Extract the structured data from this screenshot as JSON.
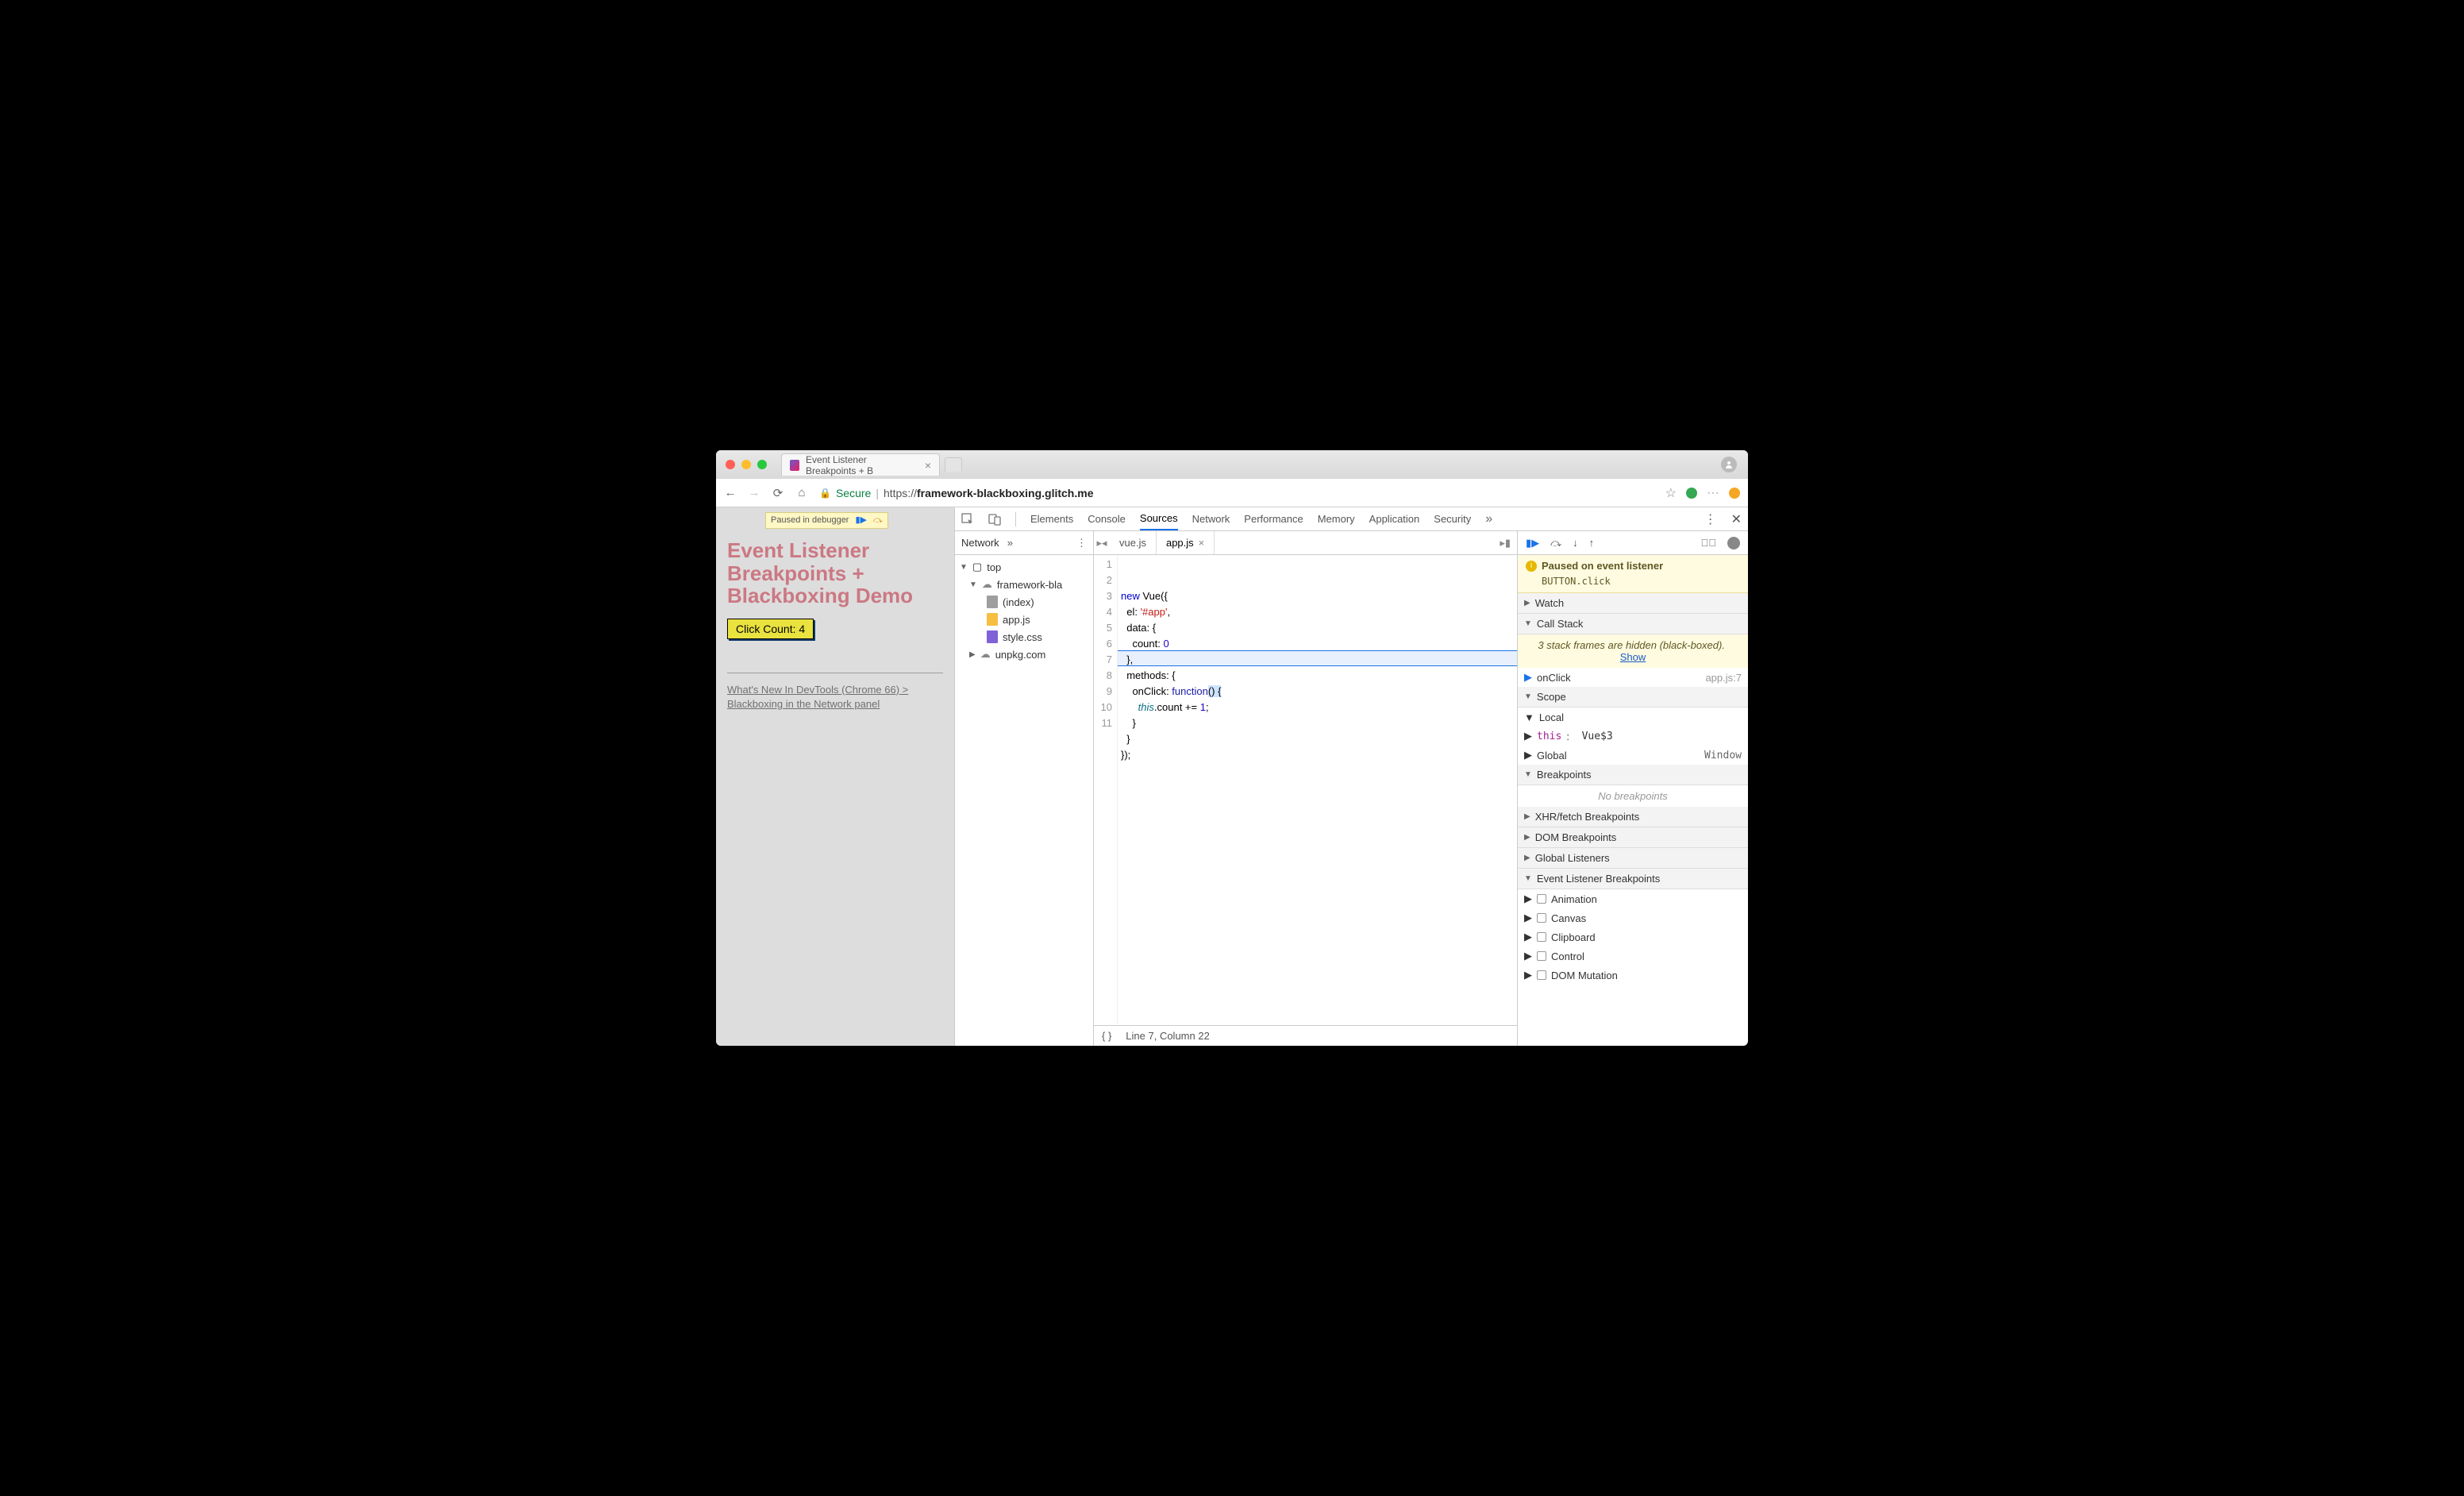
{
  "browser": {
    "tab_title": "Event Listener Breakpoints + B",
    "url_secure_label": "Secure",
    "url_display_host": "framework-blackboxing.glitch.me",
    "url_display_prefix": "https://"
  },
  "page": {
    "paused_pill": "Paused in debugger",
    "heading": "Event Listener Breakpoints + Blackboxing Demo",
    "button_label": "Click Count: 4",
    "link_text": "What's New In DevTools (Chrome 66) > Blackboxing in the Network panel"
  },
  "devtools": {
    "tabs": [
      "Elements",
      "Console",
      "Sources",
      "Network",
      "Performance",
      "Memory",
      "Application",
      "Security"
    ],
    "active_tab": "Sources",
    "nav": {
      "pane": "Network",
      "tree": {
        "root": "top",
        "domain": "framework-bla",
        "files": [
          "(index)",
          "app.js",
          "style.css"
        ],
        "external": "unpkg.com"
      }
    },
    "editor": {
      "open_tabs": [
        "vue.js",
        "app.js"
      ],
      "active_tab": "app.js",
      "line_count": 11,
      "code_lines": [
        "new Vue({",
        "  el: '#app',",
        "  data: {",
        "    count: 0",
        "  },",
        "  methods: {",
        "    onClick: function() {",
        "      this.count += 1;",
        "    }",
        "  }",
        "});"
      ],
      "highlight_line": 7,
      "status": "Line 7, Column 22"
    },
    "debugger": {
      "paused_title": "Paused on event listener",
      "paused_detail": "BUTTON.click",
      "sections": {
        "watch": "Watch",
        "callstack": "Call Stack",
        "scope": "Scope",
        "breakpoints": "Breakpoints",
        "xhr": "XHR/fetch Breakpoints",
        "dom": "DOM Breakpoints",
        "global": "Global Listeners",
        "event": "Event Listener Breakpoints"
      },
      "callstack": {
        "hidden_note_pre": "3 stack frames are hidden (black-boxed).",
        "hidden_note_link": "Show",
        "frame_name": "onClick",
        "frame_loc": "app.js:7"
      },
      "scope": {
        "local": "Local",
        "this_key": "this",
        "this_val": "Vue$3",
        "global": "Global",
        "global_val": "Window"
      },
      "breakpoints_empty": "No breakpoints",
      "event_categories": [
        "Animation",
        "Canvas",
        "Clipboard",
        "Control",
        "DOM Mutation"
      ]
    }
  }
}
